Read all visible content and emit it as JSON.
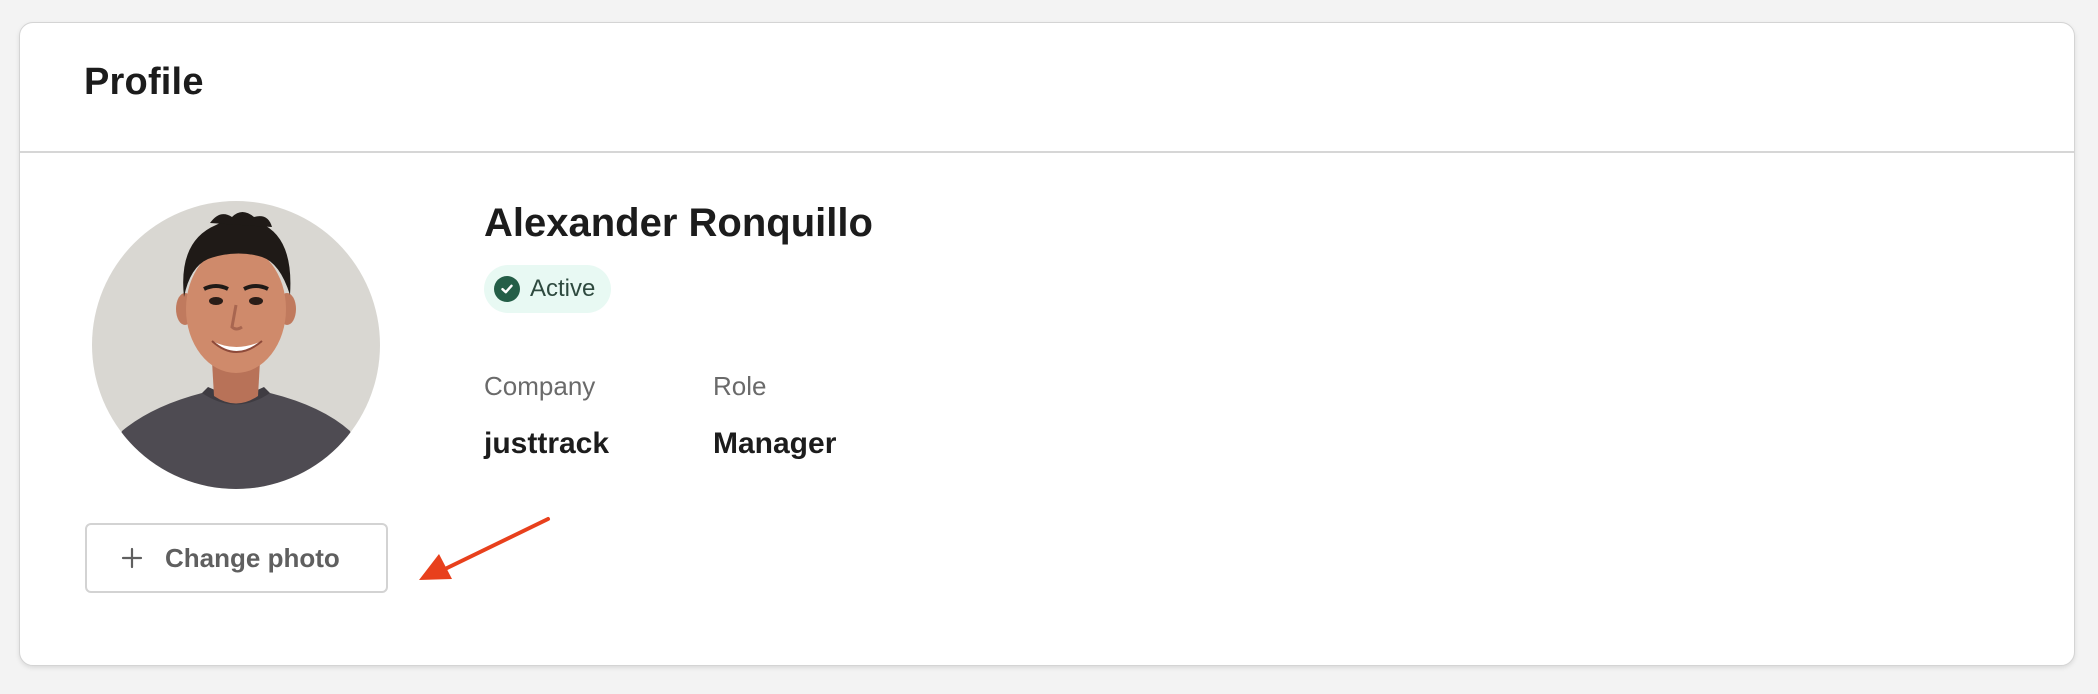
{
  "header": {
    "title": "Profile"
  },
  "profile": {
    "name": "Alexander Ronquillo",
    "status": "Active",
    "company_label": "Company",
    "company_value": "justtrack",
    "role_label": "Role",
    "role_value": "Manager"
  },
  "actions": {
    "change_photo_label": "Change photo"
  },
  "colors": {
    "status_badge_bg": "#e8f9f3",
    "status_icon": "#245e47",
    "annotation_arrow": "#e8401c"
  },
  "icons": {
    "status": "check-circle-icon",
    "change_photo": "plus-icon",
    "annotation": "red-arrow-icon"
  }
}
